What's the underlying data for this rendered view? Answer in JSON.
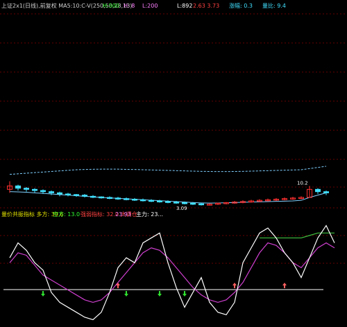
{
  "header": {
    "title": "上证2x1(日线),前复权 MA5:10:C-V(250,50,28,13)",
    "h_value": "H:500",
    "high_value": "H: 8",
    "low_value": "L:200",
    "last_value": "L:892",
    "change_value": "2.63 3.73",
    "ratio_value": "涨幅: 0.3",
    "vol_value": "量比: 9.4"
  },
  "subheader": {
    "label_1": "量价共振指标 多方: 39.6",
    "label_2": "空方: 13.0",
    "label_3": "强弱指标: 32.0 大调仓",
    "label_4": "23.93",
    "label_5": "主力: 23..."
  },
  "colors": {
    "background": "#000000",
    "grid": "#8b0000",
    "up_candle": "#ff3030",
    "down_candle": "#40e0ff",
    "ma_line": "#80d0ff",
    "white_line": "#ffffff",
    "magenta_line": "#d040d0",
    "green_line": "#40c040",
    "baseline": "#ffffff",
    "up_arrow": "#ff6060",
    "down_arrow": "#30e030",
    "header_text": "#d0d0d0",
    "header_green": "#30ff30",
    "header_red": "#ff4040",
    "header_pink": "#ff80ff",
    "header_cyan": "#40e0ff"
  },
  "chart_data": {
    "type": "candlestick",
    "title": "",
    "price_labels": {
      "top_marker": "10.2",
      "bottom_marker": "3.09"
    },
    "candles": [
      {
        "o": 7.6,
        "c": 7.9,
        "h": 8.3,
        "l": 7.3
      },
      {
        "o": 7.9,
        "c": 7.7,
        "h": 8.0,
        "l": 7.5
      },
      {
        "o": 7.7,
        "c": 7.6,
        "h": 7.8,
        "l": 7.4
      },
      {
        "o": 7.6,
        "c": 7.5,
        "h": 7.7,
        "l": 7.3
      },
      {
        "o": 7.5,
        "c": 7.4,
        "h": 7.6,
        "l": 7.2
      },
      {
        "o": 7.4,
        "c": 7.3,
        "h": 7.5,
        "l": 7.1
      },
      {
        "o": 7.3,
        "c": 7.2,
        "h": 7.4,
        "l": 7.0
      },
      {
        "o": 7.2,
        "c": 7.15,
        "h": 7.3,
        "l": 7.0
      },
      {
        "o": 7.15,
        "c": 7.1,
        "h": 7.2,
        "l": 6.95
      },
      {
        "o": 7.1,
        "c": 7.0,
        "h": 7.2,
        "l": 6.9
      },
      {
        "o": 7.0,
        "c": 6.95,
        "h": 7.1,
        "l": 6.85
      },
      {
        "o": 6.95,
        "c": 6.9,
        "h": 7.0,
        "l": 6.8
      },
      {
        "o": 6.9,
        "c": 6.85,
        "h": 7.0,
        "l": 6.75
      },
      {
        "o": 6.85,
        "c": 6.8,
        "h": 6.95,
        "l": 6.7
      },
      {
        "o": 6.8,
        "c": 6.75,
        "h": 6.9,
        "l": 6.65
      },
      {
        "o": 6.75,
        "c": 6.7,
        "h": 6.85,
        "l": 6.6
      },
      {
        "o": 6.7,
        "c": 6.65,
        "h": 6.8,
        "l": 6.55
      },
      {
        "o": 6.65,
        "c": 6.6,
        "h": 6.75,
        "l": 6.5
      },
      {
        "o": 6.6,
        "c": 6.55,
        "h": 6.7,
        "l": 6.45
      },
      {
        "o": 6.55,
        "c": 6.5,
        "h": 6.65,
        "l": 6.4
      },
      {
        "o": 6.5,
        "c": 6.45,
        "h": 6.6,
        "l": 6.35
      },
      {
        "o": 6.45,
        "c": 6.4,
        "h": 6.55,
        "l": 6.3
      },
      {
        "o": 6.4,
        "c": 6.35,
        "h": 6.5,
        "l": 6.25
      },
      {
        "o": 6.35,
        "c": 6.3,
        "h": 6.45,
        "l": 6.2
      },
      {
        "o": 6.3,
        "c": 6.32,
        "h": 6.4,
        "l": 6.2
      },
      {
        "o": 6.32,
        "c": 6.4,
        "h": 6.45,
        "l": 6.25
      },
      {
        "o": 6.4,
        "c": 6.45,
        "h": 6.5,
        "l": 6.3
      },
      {
        "o": 6.45,
        "c": 6.5,
        "h": 6.6,
        "l": 6.35
      },
      {
        "o": 6.5,
        "c": 6.55,
        "h": 6.65,
        "l": 6.4
      },
      {
        "o": 6.55,
        "c": 6.6,
        "h": 6.7,
        "l": 6.45
      },
      {
        "o": 6.6,
        "c": 6.65,
        "h": 6.75,
        "l": 6.5
      },
      {
        "o": 6.65,
        "c": 6.7,
        "h": 6.8,
        "l": 6.55
      },
      {
        "o": 6.7,
        "c": 6.75,
        "h": 6.85,
        "l": 6.6
      },
      {
        "o": 6.75,
        "c": 6.8,
        "h": 6.9,
        "l": 6.65
      },
      {
        "o": 6.8,
        "c": 6.85,
        "h": 6.95,
        "l": 6.7
      },
      {
        "o": 6.85,
        "c": 6.9,
        "h": 7.0,
        "l": 6.75
      },
      {
        "o": 6.9,
        "c": 7.6,
        "h": 7.9,
        "l": 6.9
      },
      {
        "o": 7.6,
        "c": 7.4,
        "h": 7.7,
        "l": 7.2
      },
      {
        "o": 7.4,
        "c": 7.3,
        "h": 7.5,
        "l": 7.1
      }
    ],
    "ma_upper": [
      8.9,
      8.95,
      9.0,
      9.05,
      9.1,
      9.15,
      9.2,
      9.25,
      9.3,
      9.32,
      9.34,
      9.35,
      9.35,
      9.35,
      9.33,
      9.32,
      9.3,
      9.28,
      9.26,
      9.24,
      9.22,
      9.2,
      9.18,
      9.16,
      9.15,
      9.14,
      9.14,
      9.15,
      9.16,
      9.18,
      9.2,
      9.22,
      9.24,
      9.26,
      9.28,
      9.3,
      9.4,
      9.5,
      9.6
    ],
    "ma_lower": [
      7.4,
      7.38,
      7.35,
      7.3,
      7.25,
      7.2,
      7.15,
      7.1,
      7.05,
      7.0,
      6.95,
      6.9,
      6.86,
      6.82,
      6.78,
      6.74,
      6.7,
      6.66,
      6.62,
      6.58,
      6.54,
      6.5,
      6.46,
      6.43,
      6.41,
      6.42,
      6.44,
      6.46,
      6.48,
      6.5,
      6.52,
      6.54,
      6.56,
      6.58,
      6.6,
      6.65,
      6.9,
      7.1,
      7.3
    ],
    "osc_white": [
      30,
      60,
      45,
      20,
      5,
      -40,
      -60,
      -70,
      -80,
      -90,
      -95,
      -80,
      -40,
      10,
      30,
      20,
      60,
      70,
      80,
      20,
      -30,
      -70,
      -40,
      -10,
      -60,
      -80,
      -85,
      -60,
      20,
      50,
      80,
      90,
      70,
      40,
      20,
      -10,
      30,
      70,
      95,
      60
    ],
    "osc_magenta": [
      20,
      40,
      35,
      15,
      -5,
      -15,
      -25,
      -35,
      -45,
      -55,
      -60,
      -55,
      -40,
      -20,
      0,
      20,
      40,
      50,
      45,
      30,
      10,
      -10,
      -30,
      -45,
      -55,
      -60,
      -55,
      -40,
      -20,
      10,
      40,
      60,
      55,
      40,
      20,
      10,
      30,
      50,
      60,
      50
    ],
    "osc_green": [
      null,
      null,
      null,
      null,
      null,
      null,
      null,
      null,
      null,
      null,
      null,
      null,
      null,
      null,
      null,
      null,
      null,
      null,
      null,
      null,
      null,
      null,
      null,
      null,
      null,
      null,
      null,
      null,
      null,
      null,
      70,
      70,
      70,
      70,
      70,
      70,
      75,
      80,
      80,
      80
    ],
    "signals": [
      {
        "i": 4,
        "type": "down"
      },
      {
        "i": 13,
        "type": "up"
      },
      {
        "i": 14,
        "type": "down"
      },
      {
        "i": 18,
        "type": "down"
      },
      {
        "i": 21,
        "type": "down"
      },
      {
        "i": 27,
        "type": "up"
      },
      {
        "i": 33,
        "type": "up"
      }
    ]
  }
}
